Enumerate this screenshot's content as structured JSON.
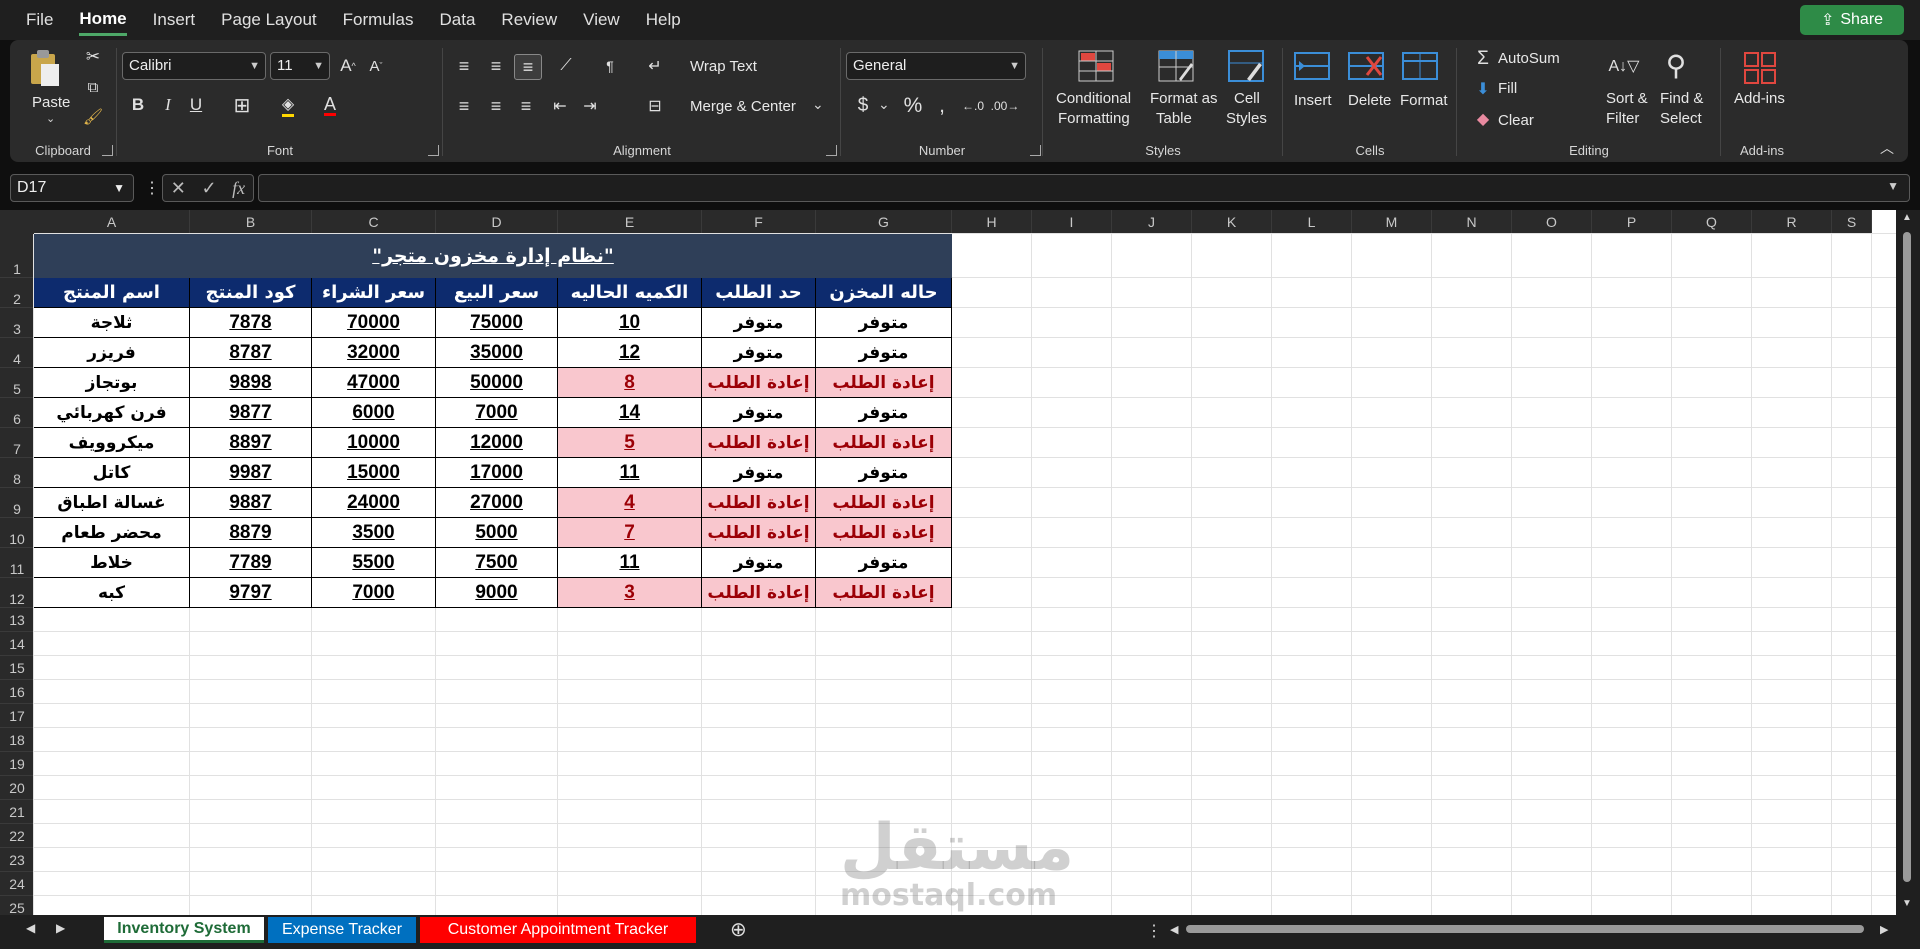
{
  "menu": {
    "tabs": [
      "File",
      "Home",
      "Insert",
      "Page Layout",
      "Formulas",
      "Data",
      "Review",
      "View",
      "Help"
    ],
    "active": "Home",
    "share": "Share"
  },
  "ribbon": {
    "clipboard": {
      "paste": "Paste",
      "label": "Clipboard"
    },
    "font": {
      "name": "Calibri",
      "size": "11",
      "label": "Font"
    },
    "alignment": {
      "wrap": "Wrap Text",
      "merge": "Merge & Center",
      "label": "Alignment"
    },
    "number": {
      "format": "General",
      "label": "Number"
    },
    "styles": {
      "conditional1": "Conditional",
      "conditional2": "Formatting",
      "fmt_table1": "Format as",
      "fmt_table2": "Table",
      "cell_styles1": "Cell",
      "cell_styles2": "Styles",
      "label": "Styles"
    },
    "cells": {
      "insert": "Insert",
      "delete": "Delete",
      "format": "Format",
      "label": "Cells"
    },
    "editing": {
      "autosum": "AutoSum",
      "fill": "Fill",
      "clear": "Clear",
      "sort1": "Sort &",
      "sort2": "Filter",
      "find1": "Find &",
      "find2": "Select",
      "label": "Editing"
    },
    "addins": {
      "btn": "Add-ins",
      "label": "Add-ins"
    }
  },
  "formula_bar": {
    "name_box": "D17",
    "value": ""
  },
  "columns": [
    "A",
    "B",
    "C",
    "D",
    "E",
    "F",
    "G",
    "H",
    "I",
    "J",
    "K",
    "L",
    "M",
    "N",
    "O",
    "P",
    "Q",
    "R",
    "S"
  ],
  "rows": [
    "1",
    "2",
    "3",
    "4",
    "5",
    "6",
    "7",
    "8",
    "9",
    "10",
    "11",
    "12",
    "13",
    "14",
    "15",
    "16",
    "17",
    "18",
    "19",
    "20",
    "21",
    "22",
    "23",
    "24",
    "25"
  ],
  "sheet": {
    "title": "\"نظام إدارة مخزون متجر\"",
    "headers": [
      "اسم المنتج",
      "كود المنتج",
      "سعر الشراء",
      "سعر البيع",
      "الكميه الحاليه",
      "حد الطلب",
      "حاله المخزن"
    ],
    "data": [
      [
        "ثلاجة",
        "7878",
        "70000",
        "75000",
        "10",
        "متوفر",
        "متوفر"
      ],
      [
        "فريزر",
        "8787",
        "32000",
        "35000",
        "12",
        "متوفر",
        "متوفر"
      ],
      [
        "بوتجاز",
        "9898",
        "47000",
        "50000",
        "8",
        "إعادة الطلب",
        "إعادة الطلب"
      ],
      [
        "فرن كهربائي",
        "9877",
        "6000",
        "7000",
        "14",
        "متوفر",
        "متوفر"
      ],
      [
        "ميكروويف",
        "8897",
        "10000",
        "12000",
        "5",
        "إعادة الطلب",
        "إعادة الطلب"
      ],
      [
        "كاتل",
        "9987",
        "15000",
        "17000",
        "11",
        "متوفر",
        "متوفر"
      ],
      [
        "غسالة اطباق",
        "9887",
        "24000",
        "27000",
        "4",
        "إعادة الطلب",
        "إعادة الطلب"
      ],
      [
        "محضر طعام",
        "8879",
        "3500",
        "5000",
        "7",
        "إعادة الطلب",
        "إعادة الطلب"
      ],
      [
        "خلاط",
        "7789",
        "5500",
        "7500",
        "11",
        "متوفر",
        "متوفر"
      ],
      [
        "كبه",
        "9797",
        "7000",
        "9000",
        "3",
        "إعادة الطلب",
        "إعادة الطلب"
      ]
    ]
  },
  "tabs": [
    {
      "name": "Inventory System",
      "color": "#ffffff",
      "text": "#1e6b37"
    },
    {
      "name": "Expense Tracker",
      "color": "#0070c0",
      "text": "#ffffff"
    },
    {
      "name": "Customer Appointment Tracker",
      "color": "#ff0000",
      "text": "#ffffff"
    }
  ],
  "watermark": {
    "ar": "مستقل",
    "en": "mostaql.com"
  }
}
